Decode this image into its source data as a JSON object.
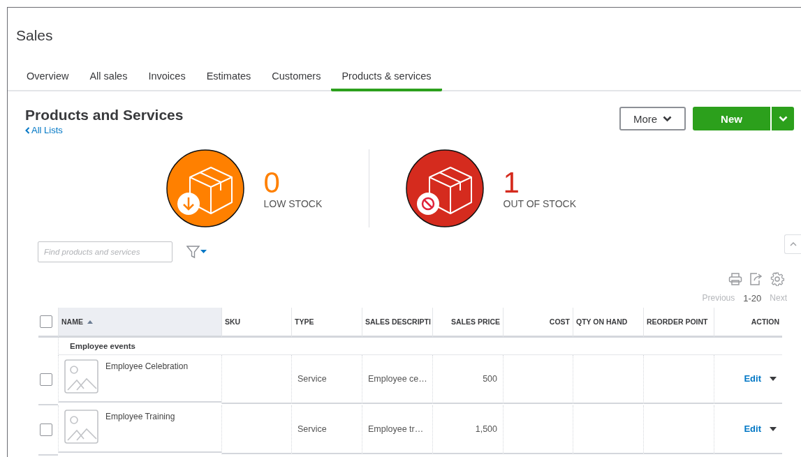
{
  "page_title": "Sales",
  "tabs": [
    {
      "label": "Overview",
      "selected": false
    },
    {
      "label": "All sales",
      "selected": false
    },
    {
      "label": "Invoices",
      "selected": false
    },
    {
      "label": "Estimates",
      "selected": false
    },
    {
      "label": "Customers",
      "selected": false
    },
    {
      "label": "Products & services",
      "selected": true
    }
  ],
  "heading": "Products and Services",
  "back_link": "All Lists",
  "buttons": {
    "more": "More",
    "new": "New"
  },
  "stats": [
    {
      "kind": "low",
      "value": "0",
      "label": "LOW STOCK",
      "color": "#ff8000"
    },
    {
      "kind": "out",
      "value": "1",
      "label": "OUT OF STOCK",
      "color": "#d52b1e"
    }
  ],
  "search": {
    "placeholder": "Find products and services"
  },
  "pagination": {
    "previous": "Previous",
    "range": "1-20",
    "next": "Next"
  },
  "table": {
    "header_checked": false,
    "columns": [
      {
        "label": "NAME",
        "sorted": true
      },
      {
        "label": "SKU",
        "sorted": false
      },
      {
        "label": "TYPE",
        "sorted": false
      },
      {
        "label": "SALES DESCRIPTI",
        "sorted": false
      },
      {
        "label": "SALES PRICE",
        "sorted": false
      },
      {
        "label": "COST",
        "sorted": false
      },
      {
        "label": "QTY ON HAND",
        "sorted": false
      },
      {
        "label": "REORDER POINT",
        "sorted": false
      },
      {
        "label": "ACTION",
        "sorted": false
      }
    ],
    "group": "Employee events",
    "rows": [
      {
        "checked": false,
        "name": "Employee Celebration",
        "sku": "",
        "type": "Service",
        "description": "Employee ce…",
        "price": "500",
        "action": "Edit"
      },
      {
        "checked": false,
        "name": "Employee Training",
        "sku": "",
        "type": "Service",
        "description": "Employee tr…",
        "price": "1,500",
        "action": "Edit"
      }
    ]
  }
}
